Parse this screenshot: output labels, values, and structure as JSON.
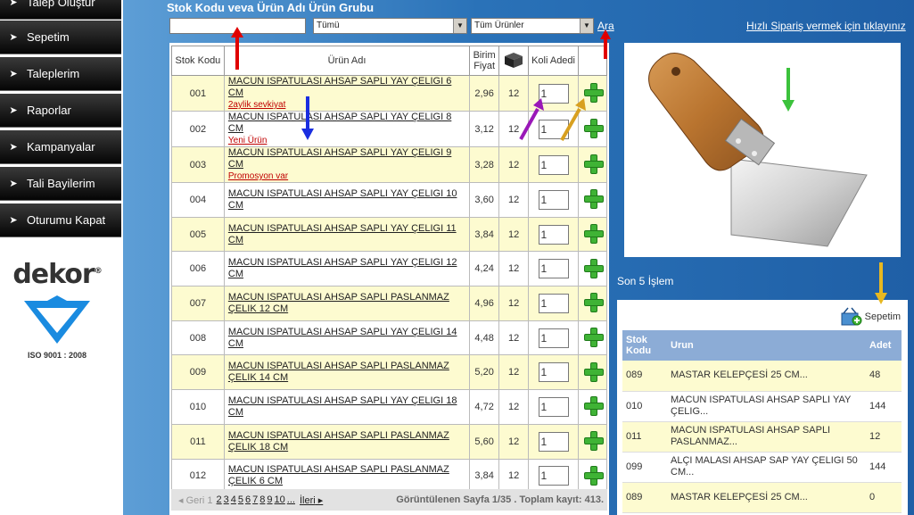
{
  "sidebar": {
    "items": [
      {
        "label": "Talep Oluştur"
      },
      {
        "label": "Sepetim"
      },
      {
        "label": "Taleplerim"
      },
      {
        "label": "Raporlar"
      },
      {
        "label": "Kampanyalar"
      },
      {
        "label": "Tali Bayilerim"
      },
      {
        "label": "Oturumu Kapat"
      }
    ],
    "logo": {
      "brand": "dekor",
      "iso": "ISO 9001 : 2008"
    }
  },
  "search": {
    "label": "Stok Kodu veva Ürün Adı  Ürün Grubu",
    "input_value": "",
    "group_select": "Tümü",
    "product_select": "Tüm Ürünler",
    "search_link": "Ara"
  },
  "quick_order_link": "Hızlı Sipariş vermek için tıklayınız",
  "table": {
    "headers": {
      "code": "Stok Kodu",
      "name": "Ürün Adı",
      "price": "Birim Fiyat",
      "qty": "Koli Adedi"
    },
    "rows": [
      {
        "code": "001",
        "name": "MACUN ISPATULASI AHSAP SAPLI YAY ÇELIGI 6 CM",
        "tag": "2aylik sevkiyat",
        "price": "2,96",
        "box": "12",
        "qty": "1"
      },
      {
        "code": "002",
        "name": "MACUN ISPATULASI AHSAP SAPLI YAY ÇELIGI 8 CM",
        "tag": "Yeni Ürün",
        "price": "3,12",
        "box": "12",
        "qty": "1"
      },
      {
        "code": "003",
        "name": "MACUN ISPATULASI AHSAP SAPLI YAY ÇELIGI 9 CM",
        "tag": "Promosyon var",
        "price": "3,28",
        "box": "12",
        "qty": "1"
      },
      {
        "code": "004",
        "name": "MACUN ISPATULASI AHSAP SAPLI YAY ÇELIGI 10 CM",
        "tag": "",
        "price": "3,60",
        "box": "12",
        "qty": "1"
      },
      {
        "code": "005",
        "name": "MACUN ISPATULASI AHSAP SAPLI YAY ÇELIGI 11 CM",
        "tag": "",
        "price": "3,84",
        "box": "12",
        "qty": "1"
      },
      {
        "code": "006",
        "name": "MACUN ISPATULASI AHSAP SAPLI YAY ÇELIGI 12 CM",
        "tag": "",
        "price": "4,24",
        "box": "12",
        "qty": "1"
      },
      {
        "code": "007",
        "name": "MACUN ISPATULASI AHSAP SAPLI PASLANMAZ ÇELIK 12 CM",
        "tag": "",
        "price": "4,96",
        "box": "12",
        "qty": "1"
      },
      {
        "code": "008",
        "name": "MACUN ISPATULASI AHSAP SAPLI YAY ÇELIGI 14 CM",
        "tag": "",
        "price": "4,48",
        "box": "12",
        "qty": "1"
      },
      {
        "code": "009",
        "name": "MACUN ISPATULASI AHSAP SAPLI PASLANMAZ ÇELIK 14 CM",
        "tag": "",
        "price": "5,20",
        "box": "12",
        "qty": "1"
      },
      {
        "code": "010",
        "name": "MACUN ISPATULASI AHSAP SAPLI YAY ÇELIGI 18 CM",
        "tag": "",
        "price": "4,72",
        "box": "12",
        "qty": "1"
      },
      {
        "code": "011",
        "name": "MACUN ISPATULASI AHSAP SAPLI PASLANMAZ ÇELIK 18 CM",
        "tag": "",
        "price": "5,60",
        "box": "12",
        "qty": "1"
      },
      {
        "code": "012",
        "name": "MACUN ISPATULASI AHSAP SAPLI PASLANMAZ ÇELIK 6 CM",
        "tag": "",
        "price": "3,84",
        "box": "12",
        "qty": "1"
      }
    ]
  },
  "pager": {
    "prev": "Geri",
    "current": "1",
    "pages": [
      "2",
      "3",
      "4",
      "5",
      "6",
      "7",
      "8",
      "9",
      "10",
      "..."
    ],
    "next": "İleri",
    "info": "Görüntülenen Sayfa 1/35 . Toplam kayıt: 413."
  },
  "recent": {
    "title": "Son 5 İşlem",
    "cart_label": "Sepetim",
    "headers": {
      "code": "Stok Kodu",
      "name": "Urun",
      "qty": "Adet"
    },
    "rows": [
      {
        "code": "089",
        "name": "MASTAR KELEPÇESİ 25 CM...",
        "qty": "48"
      },
      {
        "code": "010",
        "name": "MACUN ISPATULASI AHSAP SAPLI YAY ÇELIG...",
        "qty": "144"
      },
      {
        "code": "011",
        "name": "MACUN ISPATULASI AHSAP SAPLI PASLANMAZ...",
        "qty": "12"
      },
      {
        "code": "099",
        "name": "ALÇI MALASI AHSAP SAP YAY ÇELIGI 50 CM...",
        "qty": "144"
      },
      {
        "code": "089",
        "name": "MASTAR KELEPÇESİ 25 CM...",
        "qty": "0"
      }
    ]
  },
  "colors": {
    "panel_blue": "#2a72b8",
    "row_yellow": "#fdfbd0",
    "tag_red": "#c00000",
    "plus_green": "#3fb335",
    "recent_header": "#8cacd6"
  }
}
